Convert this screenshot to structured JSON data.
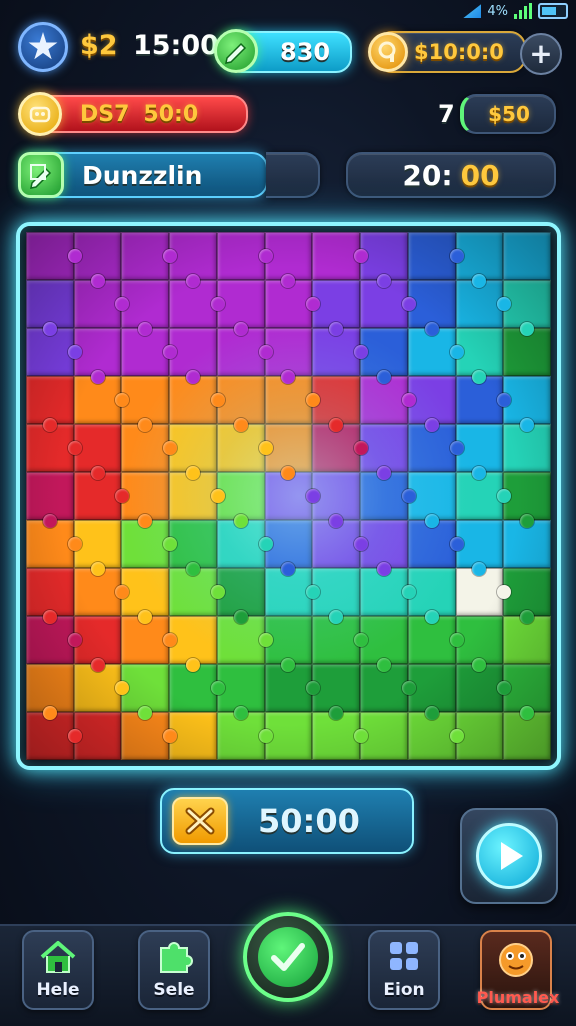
{
  "status_bar": {
    "signal_text": "4%"
  },
  "top_row": {
    "star_icon": "star-icon",
    "left_value_prefix": "$2",
    "left_value": "15:00",
    "green_pill_value": "830",
    "gold_pill_value": "$10:0:0",
    "plus_label": "+"
  },
  "second_row": {
    "red_pill_label": "DS7",
    "red_pill_value": "50:0",
    "count_label": "7",
    "small_pill_value": "$50"
  },
  "third_row": {
    "name_value": "Dunzzlin",
    "timer_left": "20:",
    "timer_right": "00"
  },
  "board": {
    "rows": 11,
    "cols": 11,
    "palette": [
      "#1e9e3a",
      "#2fbf3f",
      "#6fe03a",
      "#ffc21a",
      "#ff8a1a",
      "#e52a2a",
      "#c2185b",
      "#b02bd1",
      "#7b3fe4",
      "#2b5fd9",
      "#19b6e6",
      "#25d3b7",
      "#f4f4e8"
    ]
  },
  "timer_bar": {
    "value": "50:00"
  },
  "nav": {
    "home_label": "Hele",
    "piece_label": "Sele",
    "grid_label": "Eion",
    "profile_label": "Plumalex"
  },
  "colors": {
    "accent": "#8ff6ff",
    "gold": "#ffc83d",
    "green": "#5ff57a",
    "red": "#ff4a4a"
  }
}
